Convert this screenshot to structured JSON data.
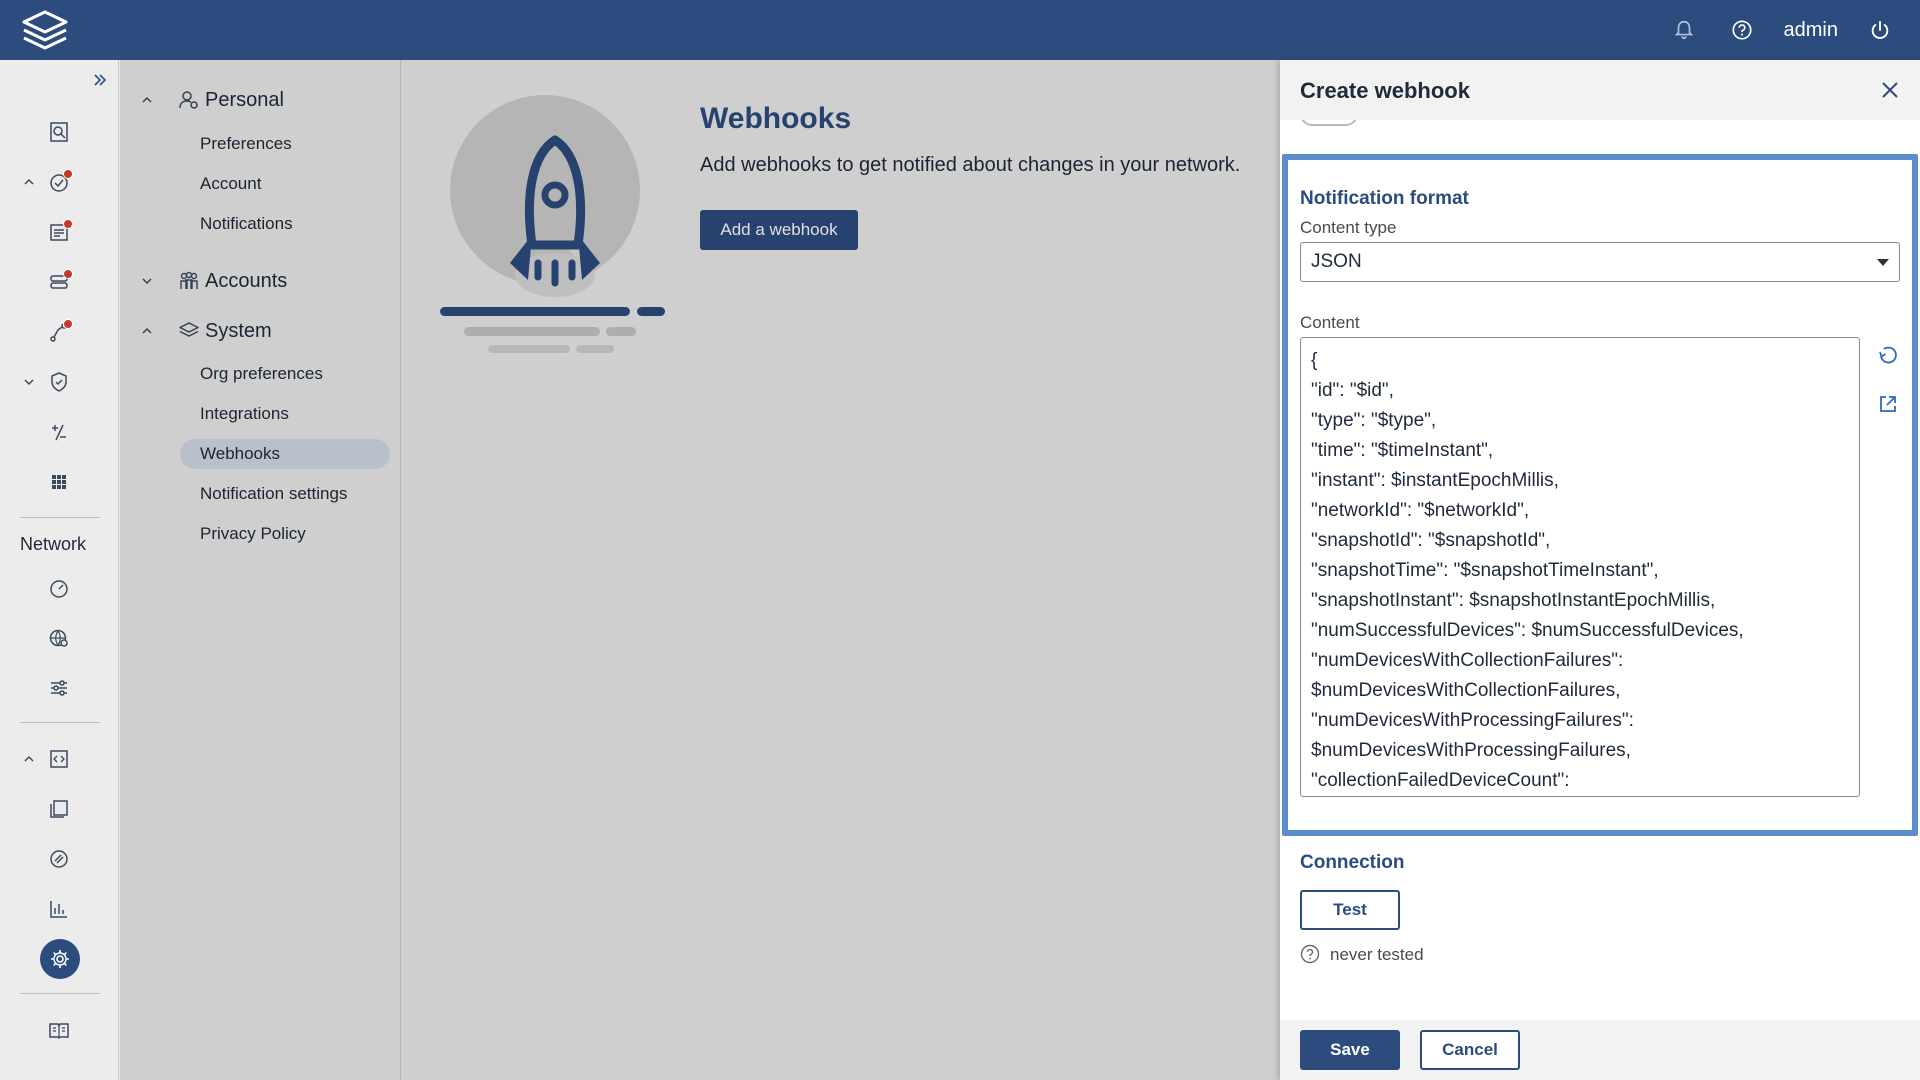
{
  "topbar": {
    "user": "admin",
    "icons": [
      "bell-icon",
      "help-icon",
      "power-icon"
    ]
  },
  "rail": {
    "network_label": "Network"
  },
  "subnav": {
    "personal": {
      "label": "Personal",
      "items": [
        "Preferences",
        "Account",
        "Notifications"
      ]
    },
    "accounts": {
      "label": "Accounts"
    },
    "system": {
      "label": "System",
      "items": [
        "Org preferences",
        "Integrations",
        "Webhooks",
        "Notification settings",
        "Privacy Policy"
      ],
      "active": "Webhooks"
    }
  },
  "main": {
    "title": "Webhooks",
    "description": "Add webhooks to get notified about changes in your network.",
    "add_button": "Add a webhook"
  },
  "drawer": {
    "title": "Create webhook",
    "notification_format": {
      "section_title": "Notification format",
      "content_type_label": "Content type",
      "content_type_value": "JSON",
      "content_label": "Content",
      "content": "{\n\"id\": \"$id\",\n\"type\": \"$type\",\n\"time\": \"$timeInstant\",\n\"instant\": $instantEpochMillis,\n\"networkId\": \"$networkId\",\n\"snapshotId\": \"$snapshotId\",\n\"snapshotTime\": \"$snapshotTimeInstant\",\n\"snapshotInstant\": $snapshotInstantEpochMillis,\n\"numSuccessfulDevices\": $numSuccessfulDevices,\n\"numDevicesWithCollectionFailures\":\n$numDevicesWithCollectionFailures,\n\"numDevicesWithProcessingFailures\":\n$numDevicesWithProcessingFailures,\n\"collectionFailedDeviceCount\":"
    },
    "connection": {
      "section_title": "Connection",
      "test_button": "Test",
      "status": "never tested"
    },
    "footer": {
      "save": "Save",
      "cancel": "Cancel"
    }
  },
  "colors": {
    "brand": "#2d4c7e",
    "focus": "#5b8ccc",
    "badge": "#c0392b"
  }
}
